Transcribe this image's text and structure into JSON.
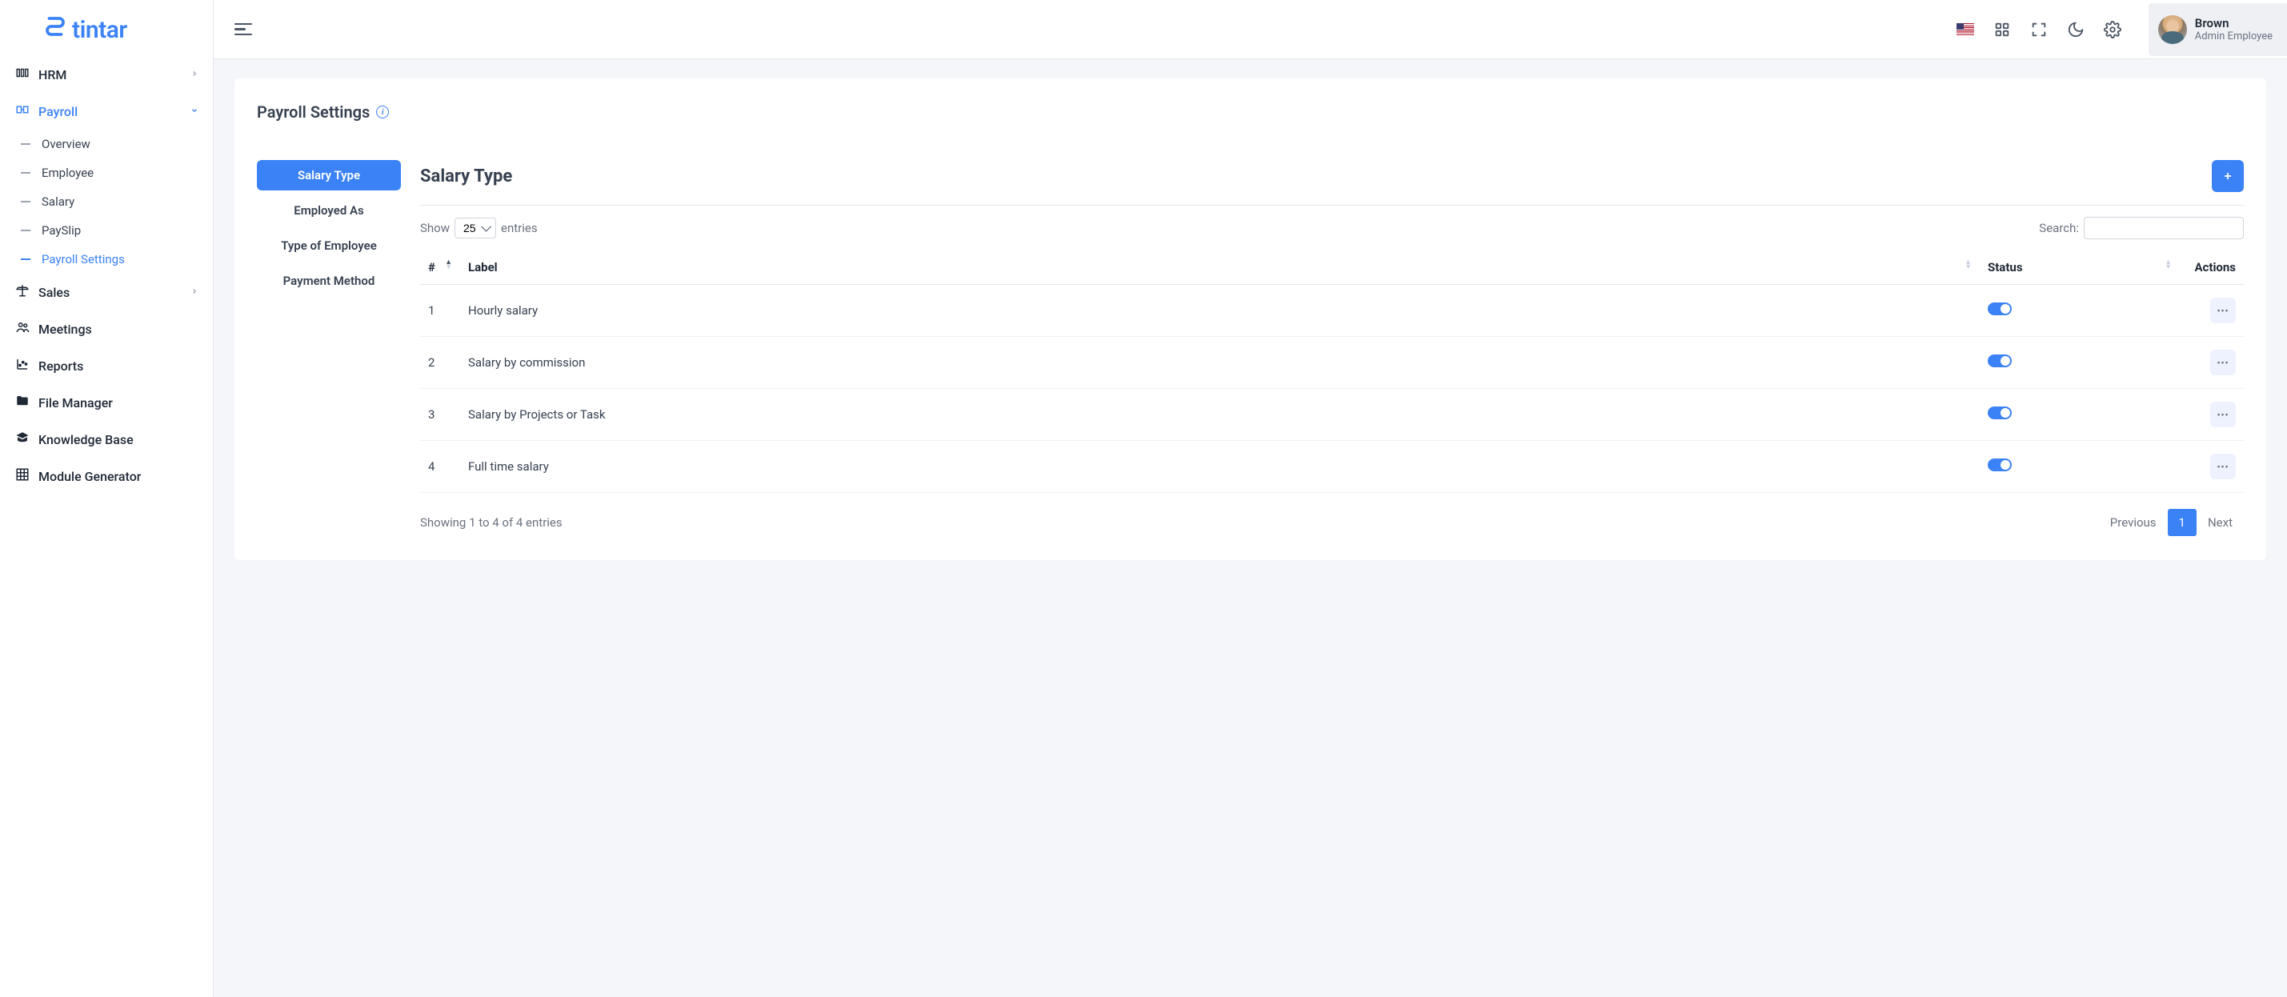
{
  "brand": "tintar",
  "sidebar": {
    "items": [
      {
        "label": "HRM",
        "icon": "hrm",
        "chev": "right"
      },
      {
        "label": "Payroll",
        "icon": "payroll",
        "chev": "down",
        "active": true
      },
      {
        "label": "Sales",
        "icon": "sales",
        "chev": "right"
      },
      {
        "label": "Meetings",
        "icon": "meetings"
      },
      {
        "label": "Reports",
        "icon": "reports"
      },
      {
        "label": "File Manager",
        "icon": "files"
      },
      {
        "label": "Knowledge Base",
        "icon": "kb"
      },
      {
        "label": "Module Generator",
        "icon": "grid"
      }
    ],
    "payroll_sub": [
      {
        "label": "Overview"
      },
      {
        "label": "Employee"
      },
      {
        "label": "Salary"
      },
      {
        "label": "PaySlip"
      },
      {
        "label": "Payroll Settings",
        "active": true
      }
    ]
  },
  "user": {
    "name": "Brown",
    "role": "Admin Employee"
  },
  "page": {
    "title": "Payroll Settings",
    "tabs": [
      {
        "label": "Salary Type",
        "active": true
      },
      {
        "label": "Employed As"
      },
      {
        "label": "Type of Employee"
      },
      {
        "label": "Payment Method"
      }
    ],
    "panel_title": "Salary Type"
  },
  "table": {
    "show_label": "Show",
    "entries_label": "entries",
    "length_value": "25",
    "search_label": "Search:",
    "columns": {
      "idx": "#",
      "label": "Label",
      "status": "Status",
      "actions": "Actions"
    },
    "rows": [
      {
        "idx": "1",
        "label": "Hourly salary",
        "status": true
      },
      {
        "idx": "2",
        "label": "Salary by commission",
        "status": true
      },
      {
        "idx": "3",
        "label": "Salary by Projects or Task",
        "status": true
      },
      {
        "idx": "4",
        "label": "Full time salary",
        "status": true
      }
    ],
    "info": "Showing 1 to 4 of 4 entries",
    "pager": {
      "prev": "Previous",
      "page": "1",
      "next": "Next"
    }
  }
}
